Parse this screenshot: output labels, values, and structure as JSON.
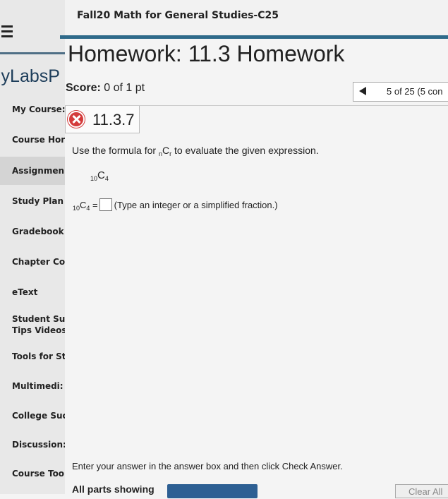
{
  "course_title": "Fall20 Math for General Studies-C25",
  "brand": "lyLabsP",
  "sidebar": {
    "items": [
      {
        "label": "My Course:"
      },
      {
        "label": "Course Hor"
      },
      {
        "label": "Assignmen"
      },
      {
        "label": "Study Plan"
      },
      {
        "label": "Gradebook"
      },
      {
        "label": "Chapter Co"
      },
      {
        "label": "eText"
      },
      {
        "label": "Student Su"
      },
      {
        "label": "Tips Videos"
      },
      {
        "label": "Tools for St"
      },
      {
        "label": "Multimedi:"
      },
      {
        "label": "College Suc"
      },
      {
        "label": "Discussion:"
      },
      {
        "label": "Course Too"
      }
    ]
  },
  "homework": {
    "title": "Homework: 11.3 Homework",
    "score_label": "Score:",
    "score_value": "0 of 1 pt",
    "position": "5 of 25 (5 con"
  },
  "question": {
    "number": "11.3.7",
    "instruction": "Use the formula for",
    "instruction_rest": "to evaluate the given expression.",
    "formula_n": "n",
    "formula_c": "C",
    "formula_r": "r",
    "expr_n": "10",
    "expr_c": "C",
    "expr_r": "4",
    "eq": "=",
    "hint": "(Type an integer or a simplified fraction.)"
  },
  "footer": {
    "message": "Enter your answer in the answer box and then click Check Answer.",
    "all_parts": "All parts showing",
    "clear_label": "Clear All"
  },
  "colors": {
    "accent": "#2f6a8a",
    "wrong": "#d43b3b",
    "button": "#2d5f93"
  }
}
